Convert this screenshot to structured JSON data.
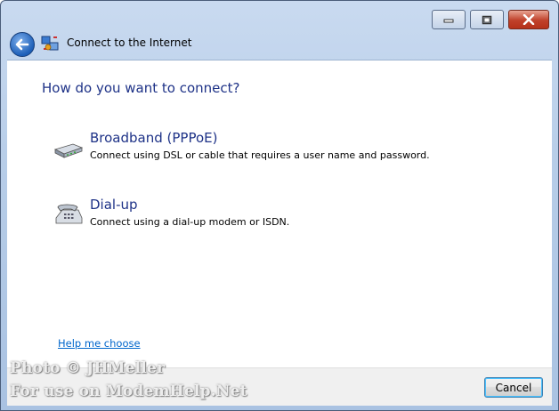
{
  "window": {
    "title": "Connect to the Internet"
  },
  "heading": "How do you want to connect?",
  "options": [
    {
      "title": "Broadband (PPPoE)",
      "description": "Connect using DSL or cable that requires a user name and password.",
      "icon": "modem-icon"
    },
    {
      "title": "Dial-up",
      "description": "Connect using a dial-up modem or ISDN.",
      "icon": "phone-icon"
    }
  ],
  "help_link": "Help me choose",
  "footer": {
    "cancel_label": "Cancel"
  },
  "watermark": {
    "line1": "Photo © JHMeller",
    "line2": "For use on ModemHelp.Net"
  }
}
